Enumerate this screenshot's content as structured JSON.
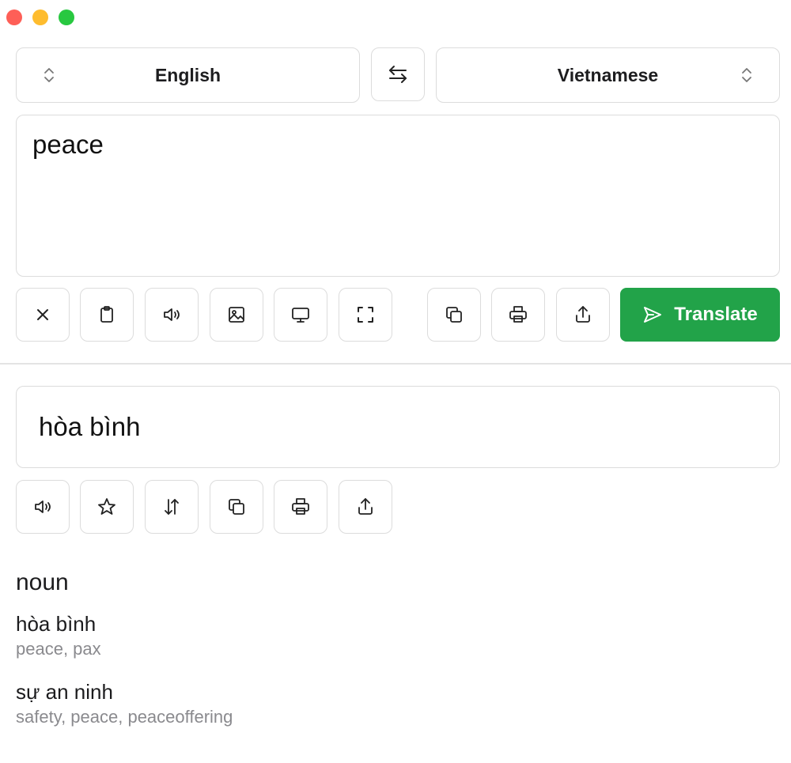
{
  "window": {
    "controls": {
      "close_color": "#fe5f57",
      "minimize_color": "#febc2e",
      "maximize_color": "#28c840"
    }
  },
  "languages": {
    "source": "English",
    "target": "Vietnamese",
    "source_icon": "chevron-up-down-icon",
    "target_icon": "chevron-up-down-icon",
    "swap_icon": "swap-arrows-icon"
  },
  "input": {
    "text": "peace"
  },
  "input_toolbar": {
    "buttons": [
      "clear-icon",
      "paste-icon",
      "speaker-icon",
      "image-icon",
      "monitor-icon",
      "fullscreen-icon",
      "copy-icon",
      "print-icon",
      "share-icon"
    ],
    "translate_label": "Translate",
    "translate_icon": "send-icon",
    "accent": "#22a349"
  },
  "output": {
    "text": "hòa bình"
  },
  "output_toolbar": {
    "buttons": [
      "speaker-icon",
      "star-icon",
      "sort-icon",
      "copy-icon",
      "print-icon",
      "share-icon"
    ]
  },
  "dictionary": {
    "part_of_speech": "noun",
    "entries": [
      {
        "term": "hòa bình",
        "synonyms": "peace, pax"
      },
      {
        "term": "sự an ninh",
        "synonyms": "safety, peace, peaceoffering"
      }
    ]
  }
}
